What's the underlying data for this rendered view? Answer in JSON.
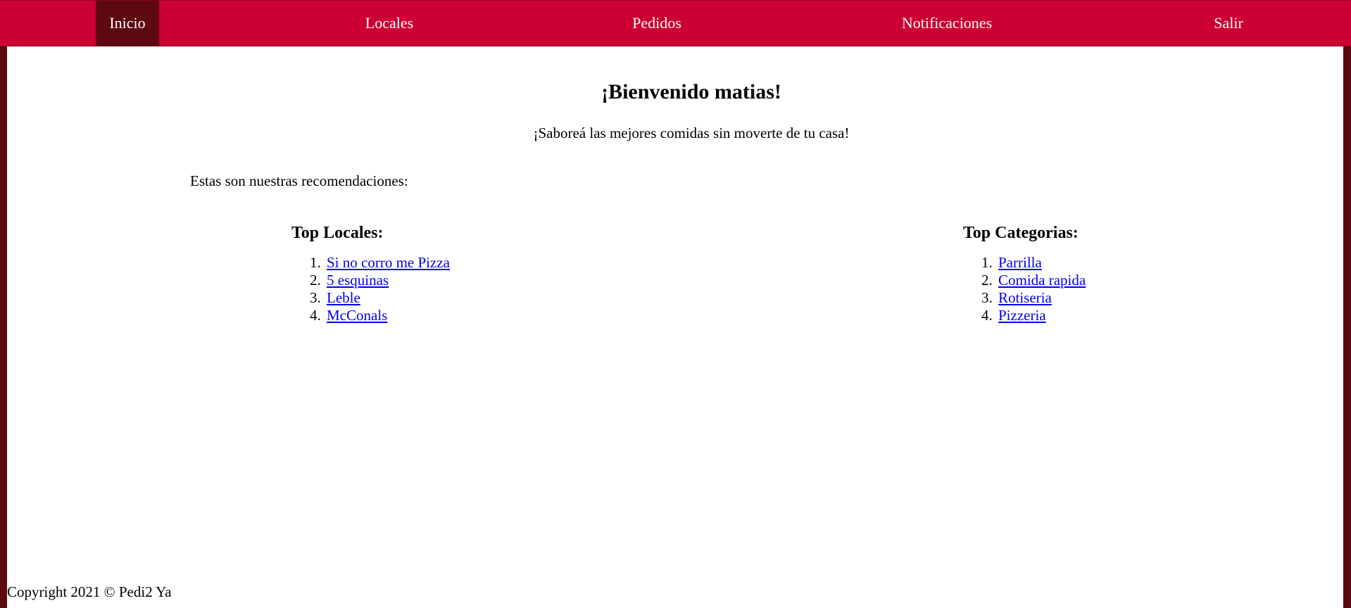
{
  "nav": {
    "items": [
      {
        "label": "Inicio",
        "active": true
      },
      {
        "label": "Locales",
        "active": false
      },
      {
        "label": "Pedidos",
        "active": false
      },
      {
        "label": "Notificaciones",
        "active": false
      },
      {
        "label": "Salir",
        "active": false
      }
    ]
  },
  "main": {
    "title": "¡Bienvenido matias!",
    "subtitle": "¡Saboreá las mejores comidas sin moverte de tu casa!",
    "intro": "Estas son nuestras recomendaciones:",
    "top_locales": {
      "heading": "Top Locales:",
      "items": [
        "Si no corro me Pizza",
        "5 esquinas",
        "Leble",
        "McConals"
      ]
    },
    "top_categorias": {
      "heading": "Top Categorias:",
      "items": [
        "Parrilla",
        "Comida rapida",
        "Rotiseria",
        "Pizzeria"
      ]
    }
  },
  "footer": {
    "copyright": "Copyright 2021 © Pedi2 Ya"
  },
  "colors": {
    "nav_bg": "#cc0033",
    "nav_active_bg": "#5c0a10",
    "page_frame": "#5c0a10",
    "link": "#0000ee"
  }
}
